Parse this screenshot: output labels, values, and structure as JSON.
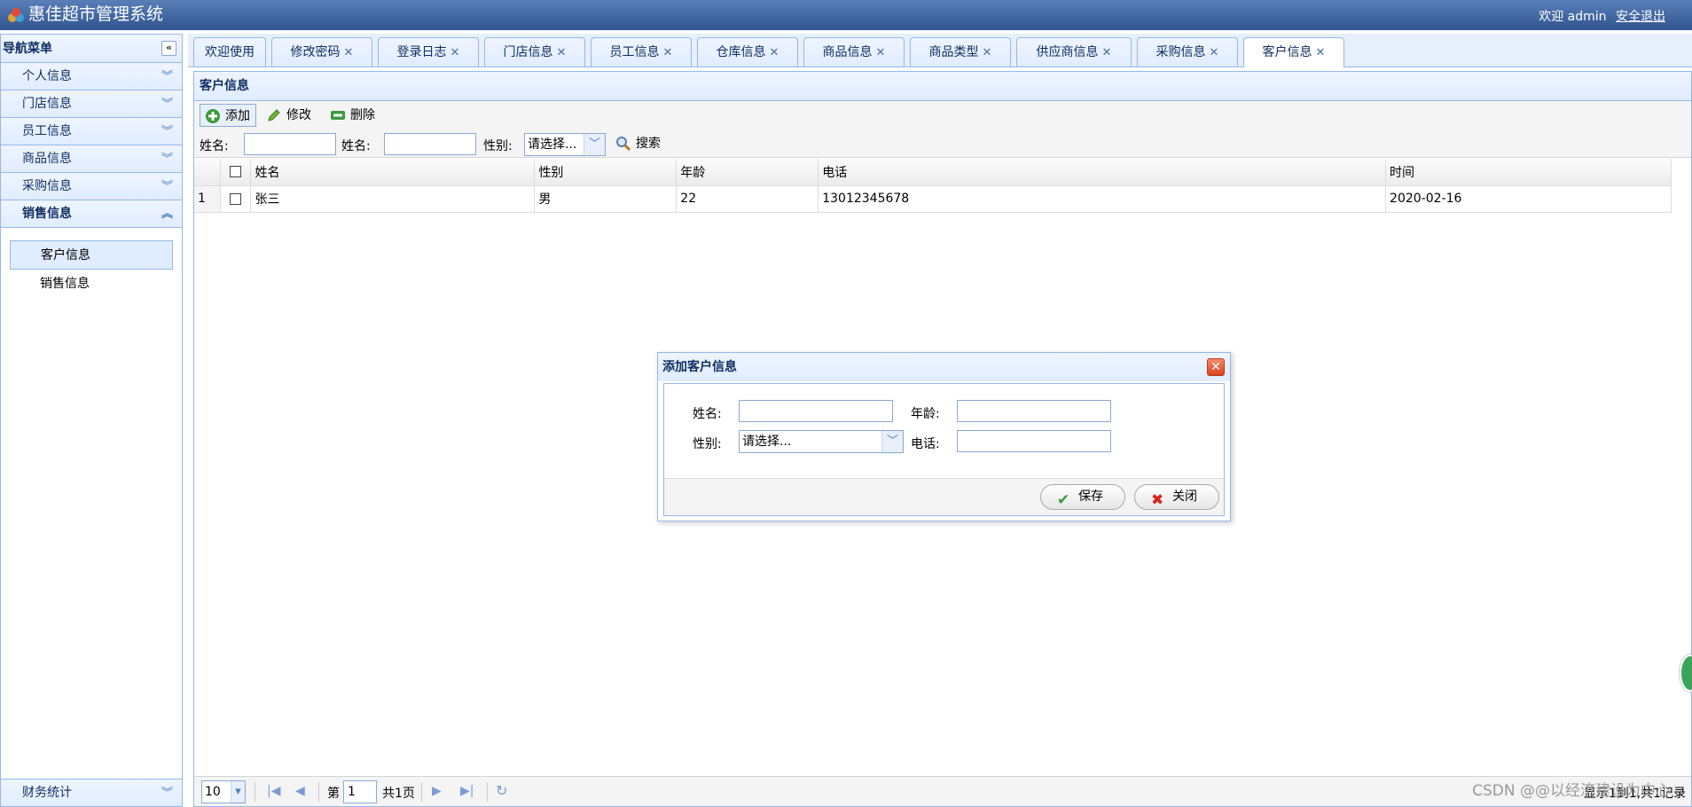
{
  "header": {
    "title": "惠佳超市管理系统",
    "welcome": "欢迎 admin",
    "logout": "安全退出"
  },
  "sidebar": {
    "title": "导航菜单",
    "groups": [
      "个人信息",
      "门店信息",
      "员工信息",
      "商品信息",
      "采购信息",
      "销售信息"
    ],
    "items": [
      "客户信息",
      "销售信息"
    ],
    "bottom_group": "财务统计"
  },
  "tabs": [
    "欢迎使用",
    "修改密码",
    "登录日志",
    "门店信息",
    "员工信息",
    "仓库信息",
    "商品信息",
    "商品类型",
    "供应商信息",
    "采购信息",
    "客户信息"
  ],
  "panel": {
    "title": "客户信息",
    "toolbar": {
      "add": "添加",
      "edit": "修改",
      "delete": "删除"
    },
    "search": {
      "name1_label": "姓名:",
      "name2_label": "姓名:",
      "gender_label": "性别:",
      "gender_value": "请选择...",
      "search_button": "搜索"
    }
  },
  "grid": {
    "columns": [
      "姓名",
      "性别",
      "年龄",
      "电话",
      "时间"
    ],
    "rows": [
      {
        "index": "1",
        "name": "张三",
        "gender": "男",
        "age": "22",
        "phone": "13012345678",
        "date": "2020-02-16"
      }
    ]
  },
  "pager": {
    "page_size": "10",
    "page_prefix": "第",
    "page_value": "1",
    "page_total": "共1页",
    "summary": "显示1到1,共1记录"
  },
  "dialog": {
    "title": "添加客户信息",
    "name_label": "姓名:",
    "age_label": "年龄:",
    "gender_label": "性别:",
    "gender_value": "请选择...",
    "phone_label": "电话:",
    "save": "保存",
    "close": "关闭"
  },
  "watermark": "CSDN @@以经济建设为中心"
}
